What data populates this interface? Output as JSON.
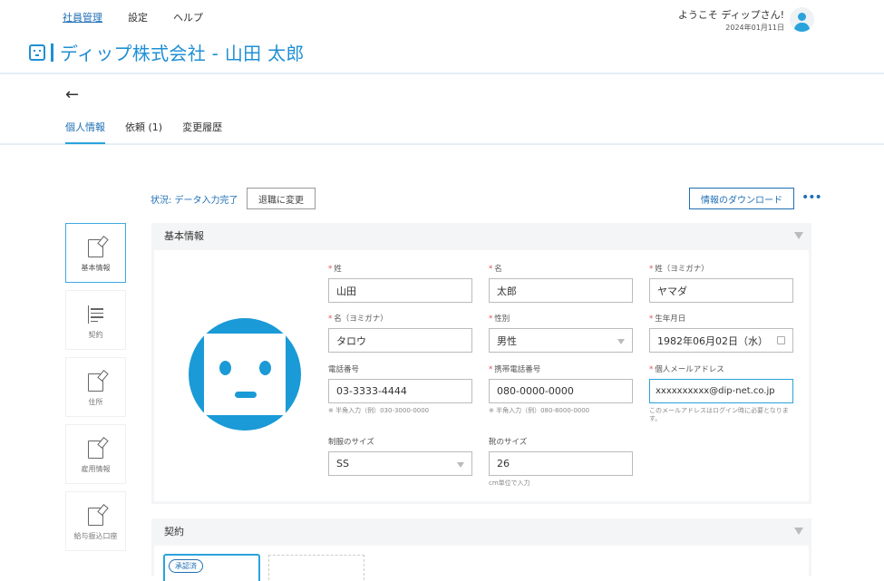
{
  "header": {
    "nav": [
      "社員管理",
      "設定",
      "ヘルプ"
    ],
    "welcome": "ようこそ ディップさん!",
    "date": "2024年01月11日",
    "title": "ディップ株式会社 - 山田 太郎"
  },
  "subheader": {
    "back": "←",
    "tabs": [
      "個人情報",
      "依頼 (1)",
      "変更履歴"
    ]
  },
  "toolbar": {
    "status": "状況: データ入力完了",
    "retire_label": "退職に変更",
    "download_label": "情報のダウンロード",
    "more": "•••"
  },
  "sidenav": [
    {
      "label": "基本情報",
      "icon": "edit-icon"
    },
    {
      "label": "契約",
      "icon": "document-icon"
    },
    {
      "label": "住所",
      "icon": "edit-icon"
    },
    {
      "label": "雇用情報",
      "icon": "edit-icon"
    },
    {
      "label": "給与振込口座",
      "icon": "edit-icon"
    }
  ],
  "basic": {
    "heading": "基本情報",
    "fields": {
      "last_name": {
        "label": "姓",
        "value": "山田"
      },
      "first_name": {
        "label": "名",
        "value": "太郎"
      },
      "last_kana": {
        "label": "姓（ヨミガナ）",
        "value": "ヤマダ"
      },
      "first_kana": {
        "label": "名（ヨミガナ）",
        "value": "タロウ"
      },
      "gender": {
        "label": "性別",
        "value": "男性"
      },
      "birthday": {
        "label": "生年月日",
        "value": "1982年06月02日（水）"
      },
      "phone": {
        "label": "電話番号",
        "value": "03-3333-4444",
        "hint": "※ 半角入力（例）030-3000-0000"
      },
      "mobile": {
        "label": "携帯電話番号",
        "value": "080-0000-0000",
        "hint": "※ 半角入力（例）080-8000-0000"
      },
      "email": {
        "label": "個人メールアドレス",
        "value": "xxxxxxxxxx@dip-net.co.jp",
        "hint": "このメールアドレスはログイン時に必要となります。"
      },
      "uniform": {
        "label": "制服のサイズ",
        "value": "SS"
      },
      "shoe": {
        "label": "靴のサイズ",
        "value": "26",
        "hint": "cm単位で入力"
      }
    }
  },
  "contract": {
    "heading": "契約",
    "badge": "承認済"
  },
  "colors": {
    "accent": "#1a9ad6",
    "link": "#1f6fb5",
    "required": "#e05050"
  }
}
